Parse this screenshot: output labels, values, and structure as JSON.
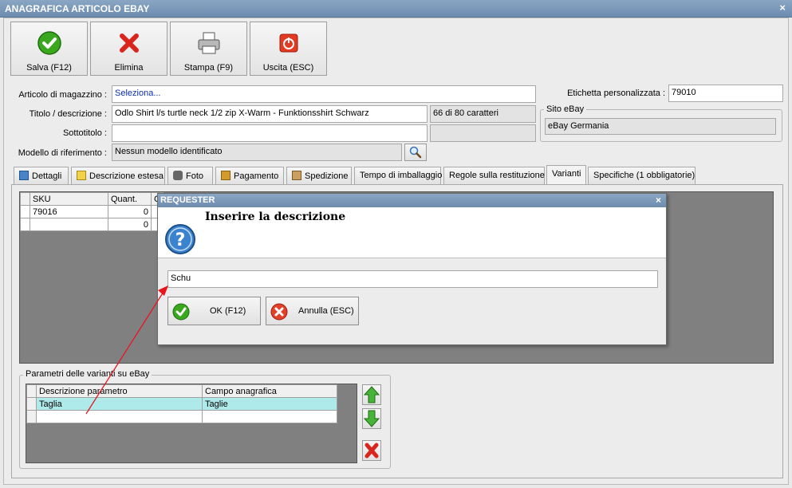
{
  "window": {
    "title": "ANAGRAFICA ARTICOLO EBAY",
    "close": "×"
  },
  "toolbar": {
    "save_label": "Salva (F12)",
    "delete_label": "Elimina",
    "print_label": "Stampa (F9)",
    "exit_label": "Uscita (ESC)"
  },
  "form": {
    "articolo_label": "Articolo di magazzino :",
    "articolo_value": "Seleziona...",
    "titolo_label": "Titolo / descrizione :",
    "titolo_value": "Odlo Shirt l/s turtle neck 1/2 zip X-Warm - Funktionsshirt Schwarz",
    "char_count": "66 di 80 caratteri",
    "sottotitolo_label": "Sottotitolo :",
    "sottotitolo_value": "",
    "modello_label": "Modello di riferimento :",
    "modello_value": "Nessun modello identificato",
    "etichetta_label": "Etichetta personalizzata :",
    "etichetta_value": "79010",
    "sito_group_label": "Sito eBay",
    "sito_value": "eBay Germania"
  },
  "tabs": [
    {
      "label": "Dettagli"
    },
    {
      "label": "Descrizione estesa"
    },
    {
      "label": "Foto"
    },
    {
      "label": "Pagamento"
    },
    {
      "label": "Spedizione"
    },
    {
      "label": "Tempo di imballaggio"
    },
    {
      "label": "Regole sulla restituzione"
    },
    {
      "label": "Varianti"
    },
    {
      "label": "Specifiche (1 obbligatorie)"
    }
  ],
  "variants_table": {
    "columns": [
      "SKU",
      "Quant.",
      "C"
    ],
    "rows": [
      {
        "sku": "79016",
        "qty": "0"
      },
      {
        "sku": "",
        "qty": "0"
      }
    ]
  },
  "params": {
    "group_label": "Parametri delle varianti su eBay",
    "columns": [
      "Descrizione parametro",
      "Campo anagrafica"
    ],
    "rows": [
      {
        "descrizione": "Taglia",
        "campo": "Taglie"
      }
    ]
  },
  "dialog": {
    "title": "REQUESTER",
    "close": "×",
    "message": "Inserire la descrizione",
    "input_value": "Schu",
    "ok_label": "OK (F12)",
    "cancel_label": "Annulla (ESC)"
  },
  "colors": {
    "titlebar": "#7a98ba",
    "selected_row": "#aeeaea",
    "annotation_arrow": "#e8141e"
  }
}
